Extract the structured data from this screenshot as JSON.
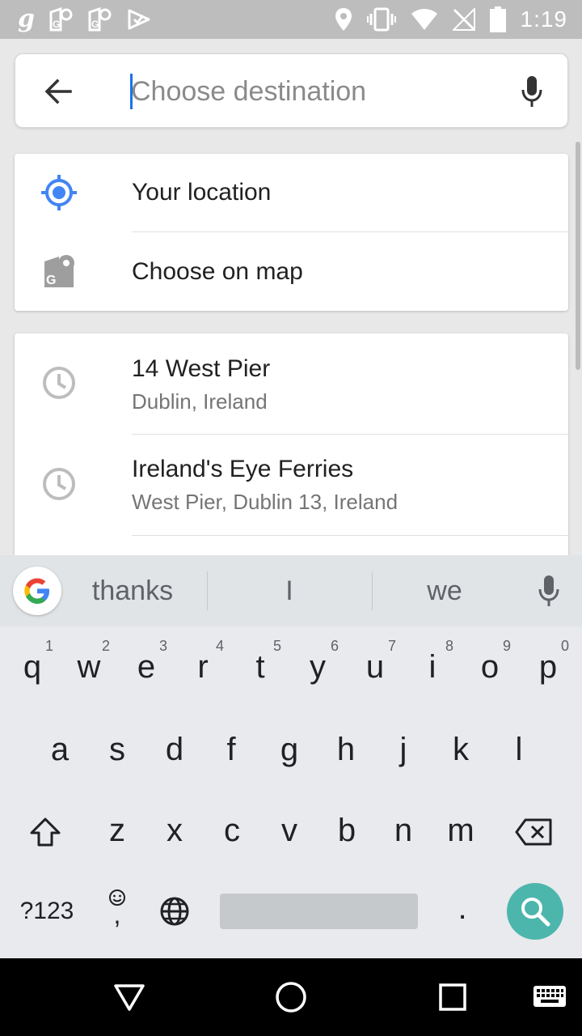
{
  "status_bar": {
    "time": "1:19",
    "left_icons": [
      "g-icon",
      "maps-icon",
      "maps-icon",
      "check-icon"
    ],
    "right_icons": [
      "location-icon",
      "vibrate-icon",
      "wifi-icon",
      "no-sim-icon",
      "battery-icon"
    ]
  },
  "search": {
    "placeholder": "Choose destination",
    "value": ""
  },
  "quick_options": [
    {
      "label": "Your location",
      "icon": "my-location-icon"
    },
    {
      "label": "Choose on map",
      "icon": "choose-on-map-icon"
    }
  ],
  "recent": [
    {
      "title": "14 West Pier",
      "subtitle": "Dublin, Ireland",
      "icon": "history-icon"
    },
    {
      "title": "Ireland's Eye Ferries",
      "subtitle": "West Pier, Dublin 13, Ireland",
      "icon": "history-icon"
    }
  ],
  "keyboard": {
    "suggestions": [
      "thanks",
      "I",
      "we"
    ],
    "row1": [
      {
        "key": "q",
        "hint": "1"
      },
      {
        "key": "w",
        "hint": "2"
      },
      {
        "key": "e",
        "hint": "3"
      },
      {
        "key": "r",
        "hint": "4"
      },
      {
        "key": "t",
        "hint": "5"
      },
      {
        "key": "y",
        "hint": "6"
      },
      {
        "key": "u",
        "hint": "7"
      },
      {
        "key": "i",
        "hint": "8"
      },
      {
        "key": "o",
        "hint": "9"
      },
      {
        "key": "p",
        "hint": "0"
      }
    ],
    "row2": [
      "a",
      "s",
      "d",
      "f",
      "g",
      "h",
      "j",
      "k",
      "l"
    ],
    "row3": [
      "z",
      "x",
      "c",
      "v",
      "b",
      "n",
      "m"
    ],
    "symbols_label": "?123",
    "comma": ",",
    "period": ".",
    "accent_color": "#4db6ac"
  }
}
